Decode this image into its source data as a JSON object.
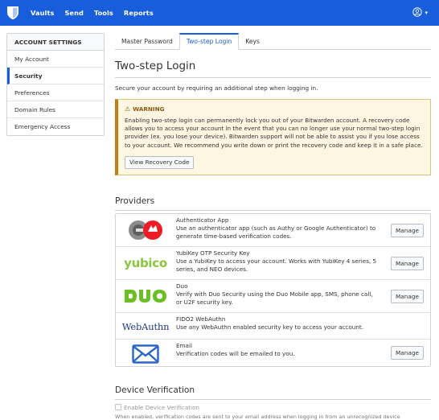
{
  "topnav": {
    "items": [
      "Vaults",
      "Send",
      "Tools",
      "Reports"
    ],
    "accent_color": "#175ddc"
  },
  "sidebar": {
    "header": "ACCOUNT SETTINGS",
    "items": [
      {
        "label": "My Account"
      },
      {
        "label": "Security",
        "active": true
      },
      {
        "label": "Preferences"
      },
      {
        "label": "Domain Rules"
      },
      {
        "label": "Emergency Access"
      }
    ]
  },
  "tabs": [
    {
      "label": "Master Password"
    },
    {
      "label": "Two-step Login",
      "active": true
    },
    {
      "label": "Keys"
    }
  ],
  "page": {
    "title": "Two-step Login",
    "subtitle": "Secure your account by requiring an additional step when logging in."
  },
  "warning": {
    "icon": "warning-triangle-icon",
    "title": "WARNING",
    "text": "Enabling two-step login can permanently lock you out of your Bitwarden account. A recovery code allows you to access your account in the event that you can no longer use your normal two-step login provider (ex. you lose your device). Bitwarden support will not be able to assist you if you lose access to your account. We recommend you write down or print the recovery code and keep it in a safe place.",
    "button": "View Recovery Code"
  },
  "providers": {
    "title": "Providers",
    "manage_label": "Manage",
    "list": [
      {
        "name": "Authenticator App",
        "description": "Use an authenticator app (such as Authy or Google Authenticator) to generate time-based verification codes.",
        "logo": "authenticator-app-logo",
        "manage": true
      },
      {
        "name": "YubiKey OTP Security Key",
        "description": "Use a YubiKey to access your account. Works with YubiKey 4 series, 5 series, and NEO devices.",
        "logo": "yubico-logo",
        "logo_text": "yubico",
        "manage": true
      },
      {
        "name": "Duo",
        "description": "Verify with Duo Security using the Duo Mobile app, SMS, phone call, or U2F security key.",
        "logo": "duo-logo",
        "manage": true
      },
      {
        "name": "FIDO2 WebAuthn",
        "description": "Use any WebAuthn enabled security key to access your account.",
        "logo": "webauthn-logo",
        "logo_text": "WebAuthn",
        "manage": false
      },
      {
        "name": "Email",
        "description": "Verification codes will be emailed to you.",
        "logo": "email-envelope-logo",
        "manage": true
      }
    ]
  },
  "device_verification": {
    "title": "Device Verification",
    "checkbox_label": "Enable Device Verification",
    "help": "When enabled, verification codes are sent to your email address when logging in from an unrecognized device"
  }
}
